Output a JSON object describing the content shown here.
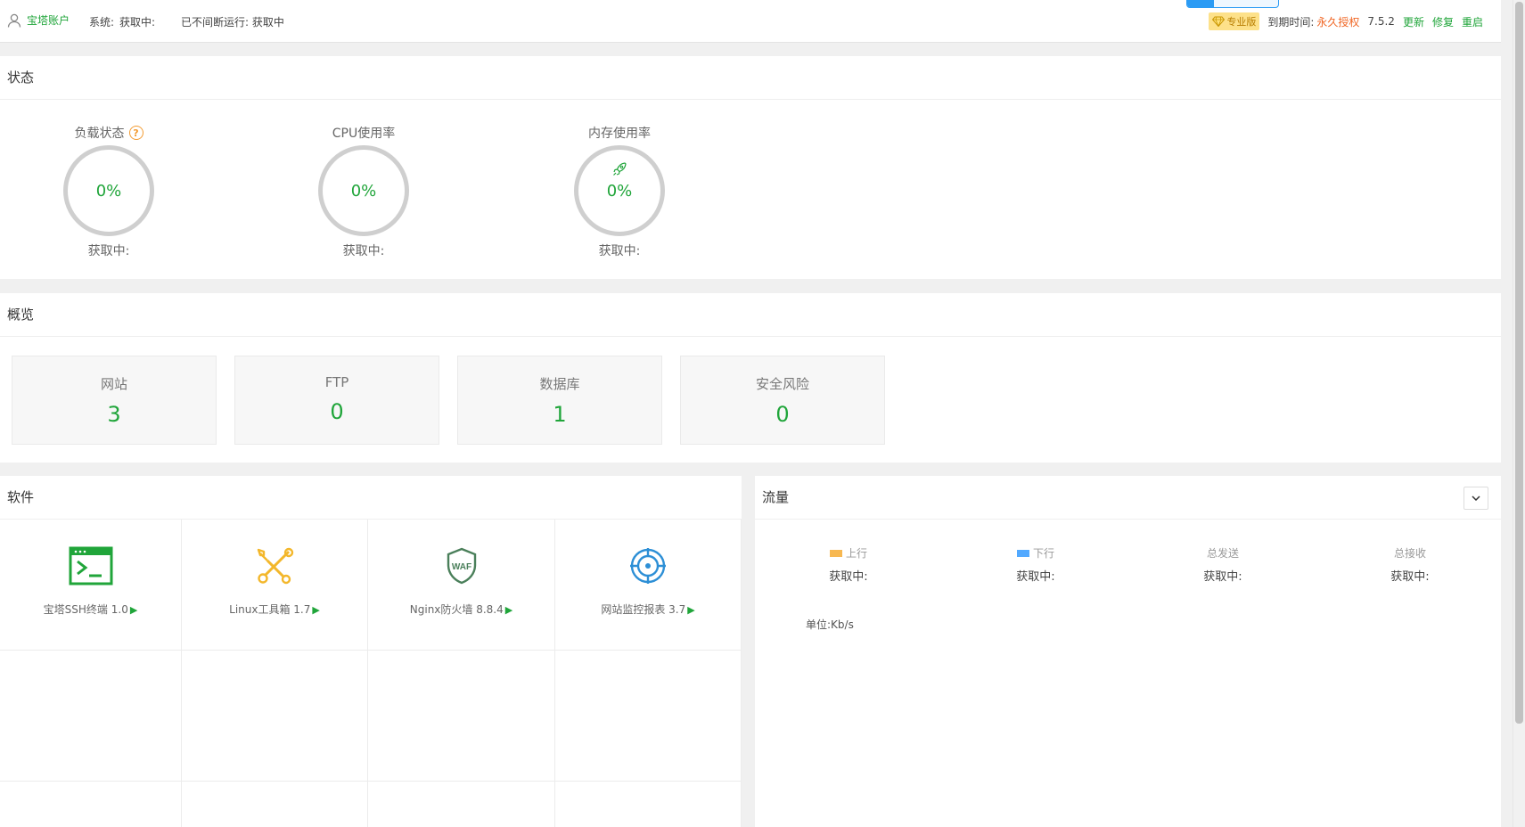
{
  "header": {
    "account_label": "宝塔账户",
    "system_label": "系统:",
    "system_value": "获取中:",
    "uptime_text": "已不间断运行: 获取中",
    "pro_badge": "专业版",
    "expire_label": "到期时间:",
    "expire_value": "永久授权",
    "version": "7.5.2",
    "update_label": "更新",
    "repair_label": "修复",
    "restart_label": "重启"
  },
  "status": {
    "title": "状态",
    "gauges": [
      {
        "label": "负载状态",
        "value": "0%",
        "sub": "获取中:"
      },
      {
        "label": "CPU使用率",
        "value": "0%",
        "sub": "获取中:"
      },
      {
        "label": "内存使用率",
        "value": "0%",
        "sub": "获取中:"
      }
    ]
  },
  "overview": {
    "title": "概览",
    "cards": [
      {
        "label": "网站",
        "value": "3"
      },
      {
        "label": "FTP",
        "value": "0"
      },
      {
        "label": "数据库",
        "value": "1"
      },
      {
        "label": "安全风险",
        "value": "0"
      }
    ]
  },
  "software": {
    "title": "软件",
    "items": [
      {
        "label": "宝塔SSH终端 1.0",
        "icon": "terminal-icon"
      },
      {
        "label": "Linux工具箱 1.7",
        "icon": "tools-icon"
      },
      {
        "label": "Nginx防火墙 8.8.4",
        "icon": "waf-shield-icon"
      },
      {
        "label": "网站监控报表 3.7",
        "icon": "monitor-target-icon"
      }
    ]
  },
  "traffic": {
    "title": "流量",
    "columns": [
      {
        "label": "上行",
        "value": "获取中:",
        "color": "#f7b851"
      },
      {
        "label": "下行",
        "value": "获取中:",
        "color": "#52a9ff"
      },
      {
        "label": "总发送",
        "value": "获取中:"
      },
      {
        "label": "总接收",
        "value": "获取中:"
      }
    ],
    "unit": "单位:Kb/s"
  },
  "colors": {
    "accent": "#20a53a",
    "warning": "#f06624"
  }
}
